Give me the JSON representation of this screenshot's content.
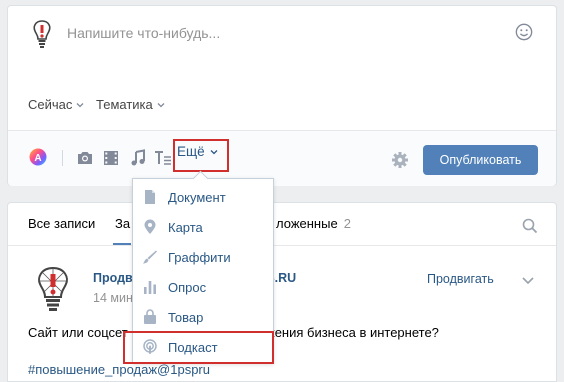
{
  "composer": {
    "placeholder": "Напишите что-нибудь...",
    "options": {
      "now": "Сейчас",
      "topic": "Тематика"
    },
    "more_label": "Ещё",
    "publish_label": "Опубликовать"
  },
  "more_menu": {
    "items": [
      {
        "label": "Документ",
        "icon": "document-icon"
      },
      {
        "label": "Карта",
        "icon": "map-pin-icon"
      },
      {
        "label": "Граффити",
        "icon": "brush-icon"
      },
      {
        "label": "Опрос",
        "icon": "poll-icon"
      },
      {
        "label": "Товар",
        "icon": "bag-icon"
      },
      {
        "label": "Подкаст",
        "icon": "podcast-icon"
      }
    ]
  },
  "wall": {
    "tabs": {
      "all": "Все записи",
      "partial": "За",
      "postponed": "ложенные",
      "postponed_count": "2"
    },
    "post": {
      "author_start": "Продв",
      "author_end": "PS.RU",
      "date": "14 мин",
      "promote": "Продвигать",
      "text_start": "Сайт или соцсет",
      "text_end": "жения бизнеса в интернете?",
      "hashtag": "#повышение_продаж@1pspru"
    }
  },
  "colors": {
    "accent": "#5181b8",
    "link": "#2a5885",
    "highlight": "#d12e2e",
    "page_bg": "#edeef0"
  }
}
